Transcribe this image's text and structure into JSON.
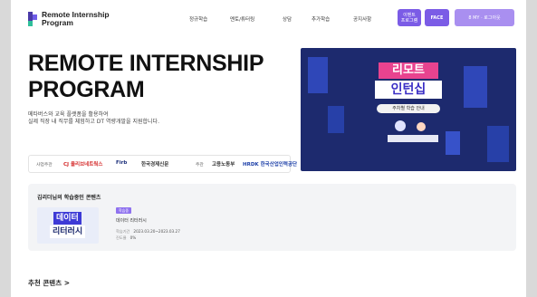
{
  "header": {
    "logo_line1": "Remote Internship",
    "logo_line2": "Program",
    "nav": [
      "정규학습",
      "멘토/튜터링",
      "상담",
      "추가학습",
      "공지사항"
    ],
    "btn_program": "이벤트\n프로그램",
    "btn_face": "FACE",
    "btn_user": "8 MY · 로그아웃"
  },
  "hero": {
    "title_line1": "REMOTE INTERNSHIP",
    "title_line2": "PROGRAM",
    "desc_line1": "메타버스와 교육 플랫폼을 활용하여",
    "desc_line2": "실제 직장 내 직무를 체험하고 DT 역량개발을 지원합니다."
  },
  "banner": {
    "title1": "리모트",
    "title2": "인턴십",
    "subtitle": "주차별 학습 안내"
  },
  "partners": {
    "host_label": "사업주관",
    "host1": "CJ 올리브네트웍스",
    "host2": "Firb",
    "host3": "한국경제신문",
    "sponsor_label": "주관",
    "sponsor1": "고용노동부",
    "sponsor2": "HRDK 한국산업인력공단"
  },
  "learning": {
    "section_title": "김리더님의 학습중인 콘텐츠",
    "thumb_line1": "데이터",
    "thumb_line2": "리터러시",
    "tag": "학습중",
    "course_name": "데이터 리터러시",
    "period_label": "학습기간",
    "period_value": "2023.03.20~2023.03.27",
    "progress_label": "진도율",
    "progress_value": "0%"
  },
  "recommend_title": "추천 콘텐츠 >"
}
